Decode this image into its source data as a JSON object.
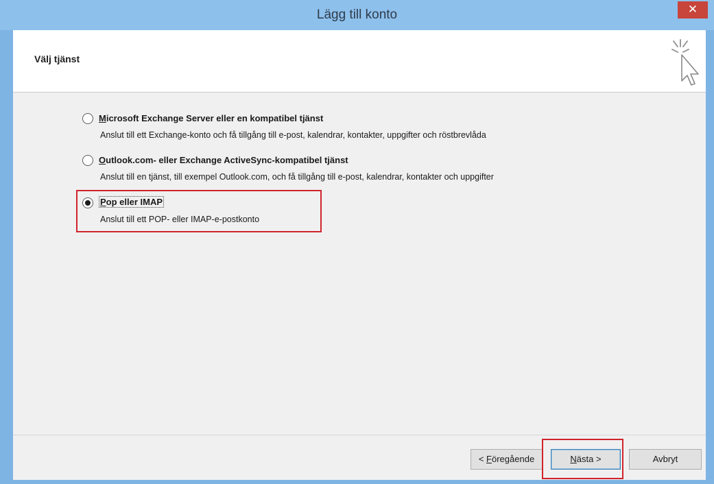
{
  "window": {
    "title": "Lägg till konto",
    "close_symbol": "✕"
  },
  "header": {
    "title": "Välj tjänst",
    "icon": "wizard-cursor-icon"
  },
  "options": [
    {
      "accel": "M",
      "label_rest": "icrosoft Exchange Server eller en kompatibel tjänst",
      "description": "Anslut till ett Exchange-konto och få tillgång till e-post, kalendrar, kontakter, uppgifter och röstbrevlåda",
      "selected": false
    },
    {
      "accel": "O",
      "label_rest": "utlook.com- eller Exchange ActiveSync-kompatibel tjänst",
      "description": "Anslut till en tjänst, till exempel Outlook.com, och få tillgång till e-post, kalendrar, kontakter och uppgifter",
      "selected": false
    },
    {
      "accel": "P",
      "label_rest": "op eller IMAP",
      "description": "Anslut till ett POP- eller IMAP-e-postkonto",
      "selected": true
    }
  ],
  "buttons": {
    "back_prefix": "< ",
    "back_accel": "F",
    "back_rest": "öregående",
    "next_accel": "N",
    "next_rest": "ästa >",
    "cancel": "Avbryt"
  },
  "colors": {
    "title_bar": "#8ec0ec",
    "close_button": "#c7453a",
    "highlight": "#d0232b"
  }
}
